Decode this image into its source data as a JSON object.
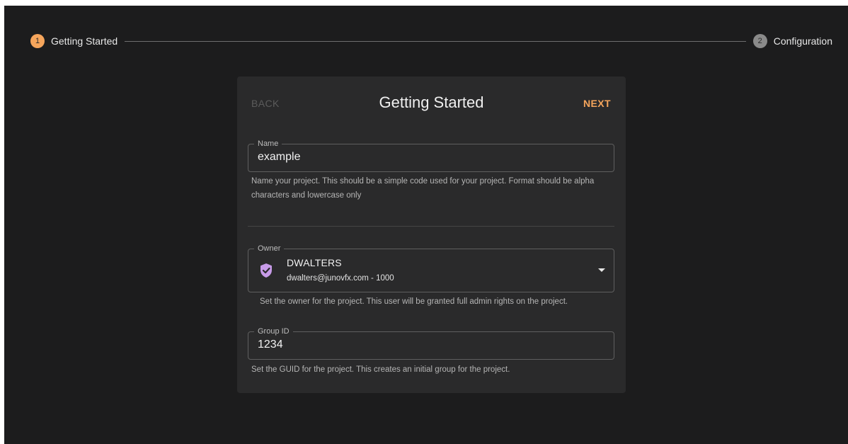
{
  "colors": {
    "accent": "#f5a55c",
    "inactive_step": "#8a8a8a",
    "shield": "#c79be8",
    "background": "#1c1c1d",
    "card": "#2a2a2b"
  },
  "stepper": {
    "steps": [
      {
        "number": "1",
        "label": "Getting Started",
        "active": true
      },
      {
        "number": "2",
        "label": "Configuration",
        "active": false
      }
    ]
  },
  "card": {
    "title": "Getting Started",
    "back_label": "BACK",
    "next_label": "NEXT"
  },
  "name_field": {
    "label": "Name",
    "value": "example",
    "helper": "Name your project. This should be a simple code used for your project. Format should be alpha characters and lowercase only"
  },
  "owner_field": {
    "label": "Owner",
    "icon": "shield-check-icon",
    "name": "DWALTERS",
    "detail": "dwalters@junovfx.com - 1000",
    "helper": "Set the owner for the project. This user will be granted full admin rights on the project."
  },
  "group_field": {
    "label": "Group ID",
    "value": "1234",
    "helper": "Set the GUID for the project. This creates an initial group for the project."
  }
}
